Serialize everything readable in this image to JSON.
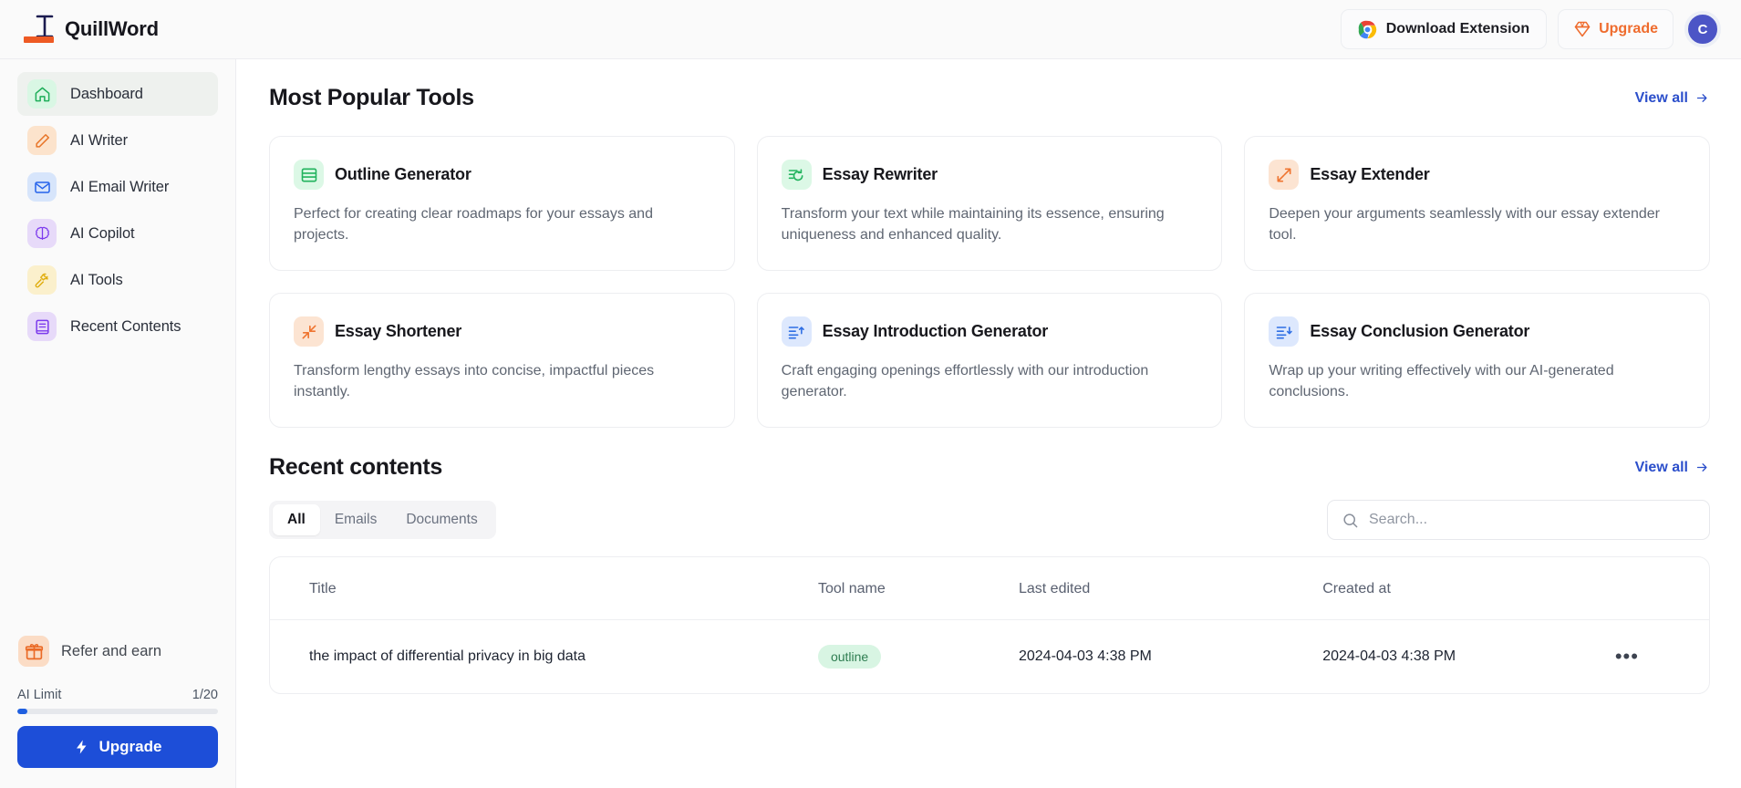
{
  "header": {
    "brand": "QuillWord",
    "download_extension_label": "Download Extension",
    "upgrade_label": "Upgrade",
    "avatar_initial": "C"
  },
  "sidebar": {
    "items": [
      {
        "label": "Dashboard",
        "icon": "home-icon",
        "active": true
      },
      {
        "label": "AI Writer",
        "icon": "pencil-icon",
        "active": false
      },
      {
        "label": "AI Email Writer",
        "icon": "envelope-icon",
        "active": false
      },
      {
        "label": "AI Copilot",
        "icon": "brain-icon",
        "active": false
      },
      {
        "label": "AI Tools",
        "icon": "hammer-icon",
        "active": false
      },
      {
        "label": "Recent Contents",
        "icon": "book-icon",
        "active": false
      }
    ],
    "refer_label": "Refer and earn",
    "refer_icon": "gift-icon",
    "limit_label": "AI Limit",
    "limit_value": "1/20",
    "limit_percent": 5,
    "upgrade_label": "Upgrade"
  },
  "main": {
    "popular": {
      "title": "Most Popular Tools",
      "view_all": "View all",
      "cards": [
        {
          "name": "Outline Generator",
          "icon": "outline-rows-icon",
          "desc": "Perfect for creating clear roadmaps for your essays and projects."
        },
        {
          "name": "Essay Rewriter",
          "icon": "rewrite-arrow-icon",
          "desc": "Transform your text while maintaining its essence, ensuring uniqueness and enhanced quality."
        },
        {
          "name": "Essay Extender",
          "icon": "expand-arrows-icon",
          "desc": "Deepen your arguments seamlessly with our essay extender tool."
        },
        {
          "name": "Essay Shortener",
          "icon": "collapse-arrows-icon",
          "desc": "Transform lengthy essays into concise, impactful pieces instantly."
        },
        {
          "name": "Essay Introduction Generator",
          "icon": "intro-lines-icon",
          "desc": "Craft engaging openings effortlessly with our introduction generator."
        },
        {
          "name": "Essay Conclusion Generator",
          "icon": "conclusion-lines-icon",
          "desc": "Wrap up your writing effectively with our AI-generated conclusions."
        }
      ]
    },
    "recent": {
      "title": "Recent contents",
      "view_all": "View all",
      "tabs": [
        {
          "label": "All",
          "active": true
        },
        {
          "label": "Emails",
          "active": false
        },
        {
          "label": "Documents",
          "active": false
        }
      ],
      "search_placeholder": "Search...",
      "search_value": "",
      "columns": [
        "Title",
        "Tool name",
        "Last edited",
        "Created at"
      ],
      "rows": [
        {
          "title": "the impact of differential privacy in big data",
          "tool": "outline",
          "last_edited": "2024-04-03 4:38 PM",
          "created_at": "2024-04-03 4:38 PM",
          "more": "•••"
        }
      ]
    }
  },
  "colors": {
    "accent_blue": "#1d4ed8",
    "link_blue": "#2c4fcb",
    "orange": "#ef6c2e",
    "green": "#22c55e",
    "badge_green_bg": "#d8f5e3",
    "badge_green_text": "#2e7d51"
  }
}
